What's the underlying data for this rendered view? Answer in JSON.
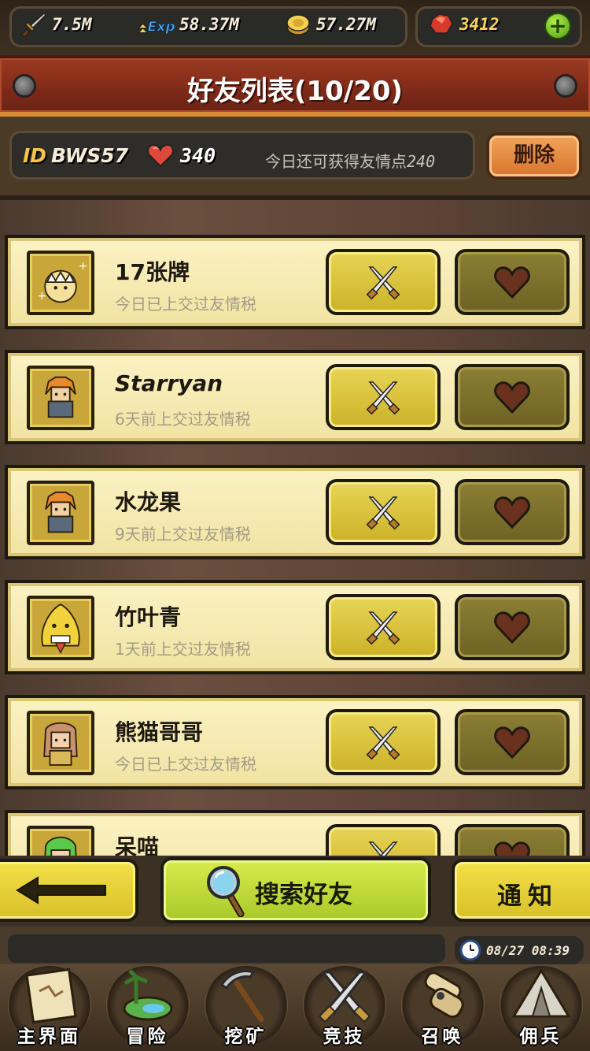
{
  "resources": {
    "attack": "7.5M",
    "exp_icon_text": "Exp",
    "exp": "58.37M",
    "gold": "57.27M",
    "gems": "3412"
  },
  "header": {
    "title": "好友列表(10/20)"
  },
  "info": {
    "id_label": "ID",
    "id_value": "BWS57",
    "hearts": "340",
    "daily_text": "今日还可获得友情点",
    "daily_points": "240",
    "delete_label": "删除"
  },
  "friends": [
    {
      "name": "17张牌",
      "status": "今日已上交过友情税"
    },
    {
      "name": "Starryan",
      "status": "6天前上交过友情税"
    },
    {
      "name": "水龙果",
      "status": "9天前上交过友情税"
    },
    {
      "name": "竹叶青",
      "status": "1天前上交过友情税"
    },
    {
      "name": "熊猫哥哥",
      "status": "今日已上交过友情税"
    },
    {
      "name": "呆喵",
      "status": ""
    }
  ],
  "actions": {
    "search_label": "搜索好友",
    "notify_label": "通知"
  },
  "status": {
    "datetime": "08/27 08:39"
  },
  "nav": [
    {
      "label": "主界面",
      "icon": "scroll-map-icon"
    },
    {
      "label": "冒险",
      "icon": "island-icon"
    },
    {
      "label": "挖矿",
      "icon": "pickaxe-icon"
    },
    {
      "label": "竞技",
      "icon": "crossed-swords-icon"
    },
    {
      "label": "召唤",
      "icon": "summon-scroll-icon"
    },
    {
      "label": "佣兵",
      "icon": "tent-icon"
    }
  ],
  "colors": {
    "banner": "#9c3a22",
    "row_bg": "#fbf2c4",
    "fight_button": "#e8d456",
    "heart_button": "#8c7e34",
    "search_button": "#d8ec4a",
    "gem": "#f8d25a"
  }
}
